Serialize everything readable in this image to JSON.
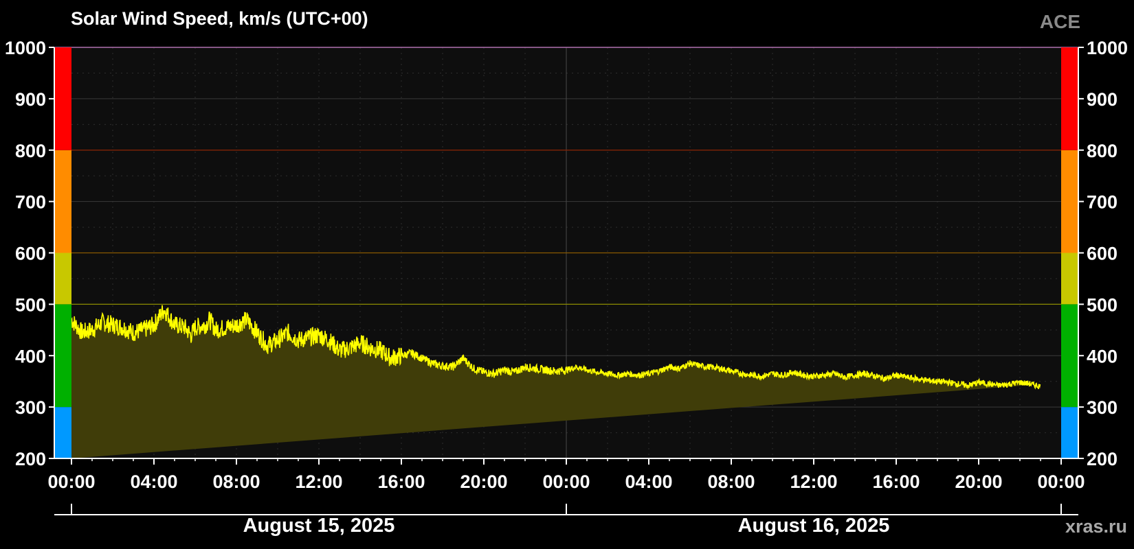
{
  "header": {
    "title": "Solar Wind Speed, km/s (UTC+00)",
    "source": "ACE"
  },
  "footer": {
    "watermark": "xras.ru"
  },
  "colors": {
    "background": "#000000",
    "plot_background": "#0e0e0e",
    "line": "#ffff00",
    "fill": "#403d09",
    "band_blue": "#0099ff",
    "band_green": "#00b000",
    "band_yellow": "#c8c800",
    "band_orange": "#ff8c00",
    "band_red": "#ff0000"
  },
  "chart_data": {
    "type": "area",
    "title": "Solar Wind Speed, km/s (UTC+00)",
    "ylim": [
      200,
      1000
    ],
    "yticks": [
      200,
      300,
      400,
      500,
      600,
      700,
      800,
      900,
      1000
    ],
    "xlim_hours": [
      0,
      48
    ],
    "xtick_hours": [
      0,
      4,
      8,
      12,
      16,
      20,
      24,
      28,
      32,
      36,
      40,
      44,
      48
    ],
    "xtick_labels": [
      "00:00",
      "04:00",
      "08:00",
      "12:00",
      "16:00",
      "20:00",
      "00:00",
      "04:00",
      "08:00",
      "12:00",
      "16:00",
      "20:00",
      "00:00"
    ],
    "date_labels": [
      {
        "label": "August 15, 2025",
        "hour": 12
      },
      {
        "label": "August 16, 2025",
        "hour": 36
      }
    ],
    "threshold_lines": [
      500,
      600,
      800
    ],
    "color_bands": [
      {
        "from": 200,
        "to": 300,
        "color": "#0099ff"
      },
      {
        "from": 300,
        "to": 500,
        "color": "#00b000"
      },
      {
        "from": 500,
        "to": 600,
        "color": "#c8c800"
      },
      {
        "from": 600,
        "to": 800,
        "color": "#ff8c00"
      },
      {
        "from": 800,
        "to": 1000,
        "color": "#ff0000"
      }
    ],
    "series": [
      {
        "x_hours": [
          0,
          0.5,
          1,
          1.5,
          2,
          2.5,
          3,
          3.5,
          4,
          4.5,
          5,
          5.5,
          5.8,
          6,
          6.5,
          6.7,
          7,
          7.5,
          8,
          8.5,
          9,
          9.5,
          10,
          10.5,
          11,
          11.5,
          12,
          12.5,
          13,
          13.5,
          14,
          14.5,
          15,
          15.5,
          16,
          16.5,
          17,
          17.5,
          18,
          18.5,
          19,
          19.5,
          20,
          20.5,
          21,
          21.5,
          22,
          22.5,
          23,
          23.5,
          24,
          24.5,
          25,
          25.5,
          26,
          26.5,
          27,
          27.5,
          28,
          28.5,
          29,
          29.5,
          30,
          30.5,
          31,
          31.5,
          32,
          32.5,
          33,
          33.5,
          34,
          34.5,
          35,
          35.5,
          36,
          36.5,
          37,
          37.5,
          38,
          38.5,
          39,
          39.5,
          40,
          40.5,
          41,
          41.5,
          42,
          42.5,
          43,
          43.5,
          44,
          44.5,
          45,
          45.5,
          46,
          46.5,
          47,
          47.5,
          48
        ],
        "values": [
          470,
          445,
          450,
          465,
          460,
          455,
          445,
          450,
          460,
          490,
          460,
          455,
          440,
          455,
          460,
          470,
          450,
          455,
          460,
          470,
          445,
          420,
          430,
          445,
          430,
          435,
          440,
          430,
          410,
          415,
          425,
          415,
          410,
          395,
          400,
          405,
          395,
          385,
          380,
          378,
          395,
          375,
          368,
          365,
          372,
          368,
          378,
          375,
          372,
          370,
          372,
          378,
          372,
          368,
          365,
          362,
          365,
          362,
          365,
          370,
          378,
          375,
          385,
          380,
          378,
          375,
          370,
          365,
          362,
          360,
          365,
          362,
          368,
          362,
          360,
          362,
          365,
          358,
          362,
          365,
          360,
          355,
          362,
          358,
          355,
          352,
          350,
          348,
          345,
          342,
          348,
          345,
          342,
          345,
          348,
          345,
          340
        ]
      }
    ]
  }
}
